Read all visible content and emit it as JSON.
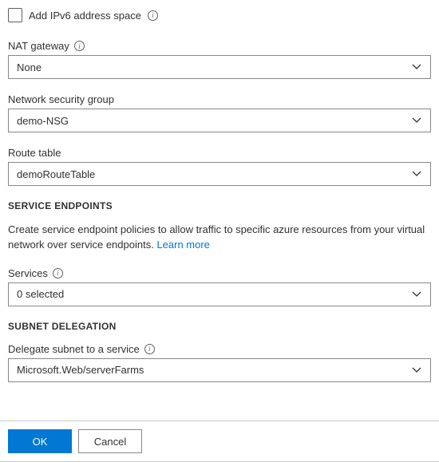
{
  "ipv6_checkbox": {
    "label": "Add IPv6 address space",
    "checked": false
  },
  "fields": {
    "nat_gateway": {
      "label": "NAT gateway",
      "value": "None"
    },
    "nsg": {
      "label": "Network security group",
      "value": "demo-NSG"
    },
    "route_table": {
      "label": "Route table",
      "value": "demoRouteTable"
    },
    "services": {
      "label": "Services",
      "value": "0 selected"
    },
    "delegate": {
      "label": "Delegate subnet to a service",
      "value": "Microsoft.Web/serverFarms"
    }
  },
  "sections": {
    "service_endpoints": {
      "heading": "SERVICE ENDPOINTS",
      "text": "Create service endpoint policies to allow traffic to specific azure resources from your virtual network over service endpoints. ",
      "learn_more": "Learn more"
    },
    "subnet_delegation": {
      "heading": "SUBNET DELEGATION"
    }
  },
  "footer": {
    "ok": "OK",
    "cancel": "Cancel"
  }
}
